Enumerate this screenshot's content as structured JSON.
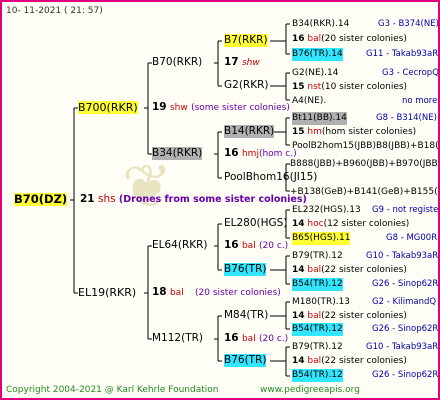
{
  "header": {
    "date": "10- 11-2021 ( 21: 57)"
  },
  "footer": {
    "copyright": "Copyright 2004-2021 @ Karl Kehrle Foundation",
    "site": "www.pedigreeapis.org"
  },
  "root": {
    "name": "B70(DZ)",
    "gen": "21",
    "marker": "shs",
    "note": "(Drones from some sister colonies)"
  },
  "l1": {
    "name": "B700(RKR)",
    "gen": "19",
    "marker": "shw",
    "note": "(some sister colonies)"
  },
  "l2": {
    "name": "EL19(RKR)",
    "gen": "18",
    "marker": "bal",
    "note": "(20 sister colonies)"
  },
  "l1a": {
    "name": "B70(RKR)",
    "gen": "17",
    "marker": "shw"
  },
  "l1b": {
    "name": "B34(RKR)",
    "gen": "16",
    "marker": "hmj",
    "note": "(hom c.)"
  },
  "l2a": {
    "name": "EL64(RKR)",
    "gen": "16",
    "marker": "bal",
    "note": "(20 c.)"
  },
  "l2b": {
    "name": "M112(TR)",
    "gen": "16",
    "marker": "bal",
    "note": "(20 c.)"
  },
  "g4": [
    {
      "name": "B7(RKR)"
    },
    {
      "name": "G2(RKR)"
    },
    {
      "name": "B14(RKR)"
    },
    {
      "name": "PoolBhom16(JI15)"
    },
    {
      "name": "EL280(HGS)"
    },
    {
      "name": "B76(TR)"
    },
    {
      "name": "M84(TR)"
    },
    {
      "name": "B76(TR)"
    }
  ],
  "g5": [
    {
      "name": "B34(RKR).14",
      "code": "G3 - B374(NE)"
    },
    {
      "gen": "16",
      "marker": "bal",
      "note": "(20 sister colonies)"
    },
    {
      "name": "B76(TR).14",
      "code": "G11 - Takab93aR"
    },
    {
      "name": "G2(NE).14",
      "code": "G3 - CecropQ"
    },
    {
      "gen": "15",
      "marker": "nst",
      "note": "(10 sister colonies)"
    },
    {
      "name": "A4(NE).",
      "code": "no more"
    },
    {
      "name": "Bt11(BB).14",
      "code": "G8 - B314(NE)"
    },
    {
      "gen": "15",
      "marker": "hm",
      "note": "(hom sister colonies)"
    },
    {
      "name": "PoolB2hom15(JBB)",
      "code": "B8(JBB)+B18(JBB)+"
    },
    {
      "name": "B888(JBB)+B960(JBB)+B970(JBB)",
      "code": "+B138(GeB)+B141(GeB)+B155(GeB)"
    },
    {
      "name": "EL232(HGS).13",
      "code": "G9 - not registe"
    },
    {
      "gen": "14",
      "marker": "hoc",
      "note": "(12 sister colonies)"
    },
    {
      "name": "B65(HGS).11",
      "code": "G8 - MG00R"
    },
    {
      "name": "B79(TR).12",
      "code": "G10 - Takab93aR"
    },
    {
      "gen": "14",
      "marker": "bal",
      "note": "(22 sister colonies)"
    },
    {
      "name": "B54(TR).12",
      "code": "G26 - Sinop62R"
    },
    {
      "name": "M180(TR).13",
      "code": "G2 - KilimandQ"
    },
    {
      "gen": "14",
      "marker": "bal",
      "note": "(22 sister colonies)"
    },
    {
      "name": "B54(TR).12",
      "code": "G26 - Sinop62R"
    },
    {
      "name": "B79(TR).12",
      "code": "G10 - Takab93aR"
    },
    {
      "gen": "14",
      "marker": "bal",
      "note": "(22 sister colonies)"
    },
    {
      "name": "B54(TR).12",
      "code": "G26 - Sinop62R"
    }
  ]
}
